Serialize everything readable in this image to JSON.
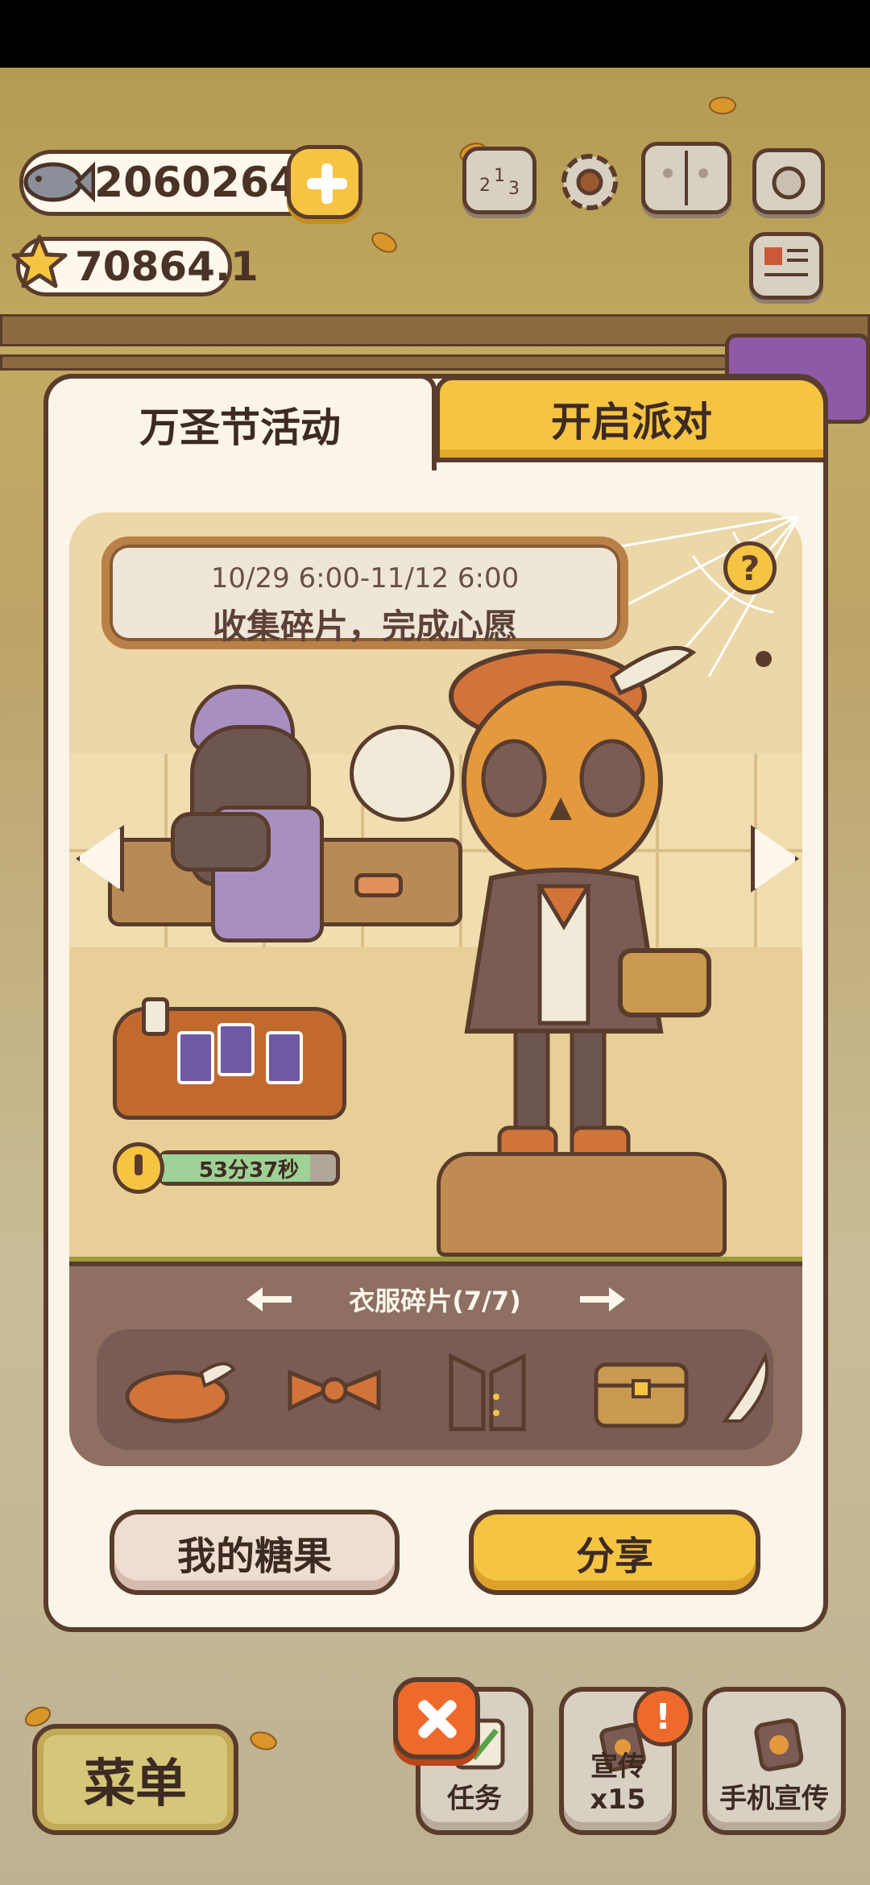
{
  "hud": {
    "fish_currency": "20602647",
    "star_currency": "70864.1",
    "icons": [
      "fish-icon",
      "plus-icon",
      "star-icon",
      "ranking-icon",
      "settings-gear-icon",
      "paw-book-icon",
      "camera-icon",
      "newspaper-icon"
    ]
  },
  "modal": {
    "tabs": [
      {
        "label": "万圣节活动",
        "active": true
      },
      {
        "label": "开启派对",
        "active": false
      }
    ],
    "event": {
      "date_range": "10/29 6:00-11/12 6:00",
      "slogan": "收集碎片，完成心愿"
    },
    "help_icon": "question-icon",
    "timer": {
      "text": "53分37秒",
      "progress": 0.85
    },
    "fragments": {
      "title": "衣服碎片(7/7)",
      "items": [
        "pumpkin-hat-icon",
        "bow-tie-icon",
        "vest-icon",
        "treasure-chest-icon",
        "feather-icon"
      ]
    },
    "buttons": {
      "candy": "我的糖果",
      "share": "分享"
    }
  },
  "bottom_bar": {
    "menu": "菜单",
    "task": "任务",
    "promote": "宣传x15",
    "phone_promote": "手机宣传",
    "badge": "!"
  },
  "colors": {
    "accent_yellow": "#f6c443",
    "outline_brown": "#5a3c2c",
    "close_orange": "#ee6a2c",
    "panel_cream": "#fbf4e8"
  }
}
